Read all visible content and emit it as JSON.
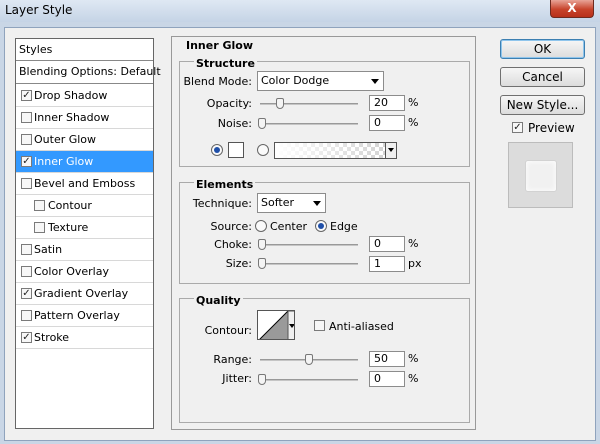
{
  "window": {
    "title": "Layer Style",
    "close": "X"
  },
  "styles_list": {
    "header": "Styles",
    "blending": "Blending Options: Default",
    "items": [
      {
        "label": "Drop Shadow",
        "checked": true
      },
      {
        "label": "Inner Shadow",
        "checked": false
      },
      {
        "label": "Outer Glow",
        "checked": false
      },
      {
        "label": "Inner Glow",
        "checked": true,
        "selected": true
      },
      {
        "label": "Bevel and Emboss",
        "checked": false
      },
      {
        "label": "Contour",
        "checked": false
      },
      {
        "label": "Texture",
        "checked": false
      },
      {
        "label": "Satin",
        "checked": false
      },
      {
        "label": "Color Overlay",
        "checked": false
      },
      {
        "label": "Gradient Overlay",
        "checked": true
      },
      {
        "label": "Pattern Overlay",
        "checked": false
      },
      {
        "label": "Stroke",
        "checked": true
      }
    ]
  },
  "panel": {
    "title": "Inner Glow",
    "structure": {
      "title": "Structure",
      "blend_mode_label": "Blend Mode:",
      "blend_mode": "Color Dodge",
      "opacity_label": "Opacity:",
      "opacity": "20",
      "noise_label": "Noise:",
      "noise": "0",
      "unit": "%",
      "color_mode": "solid"
    },
    "elements": {
      "title": "Elements",
      "technique_label": "Technique:",
      "technique": "Softer",
      "source_label": "Source:",
      "source_center": "Center",
      "source_edge": "Edge",
      "source": "Edge",
      "choke_label": "Choke:",
      "choke": "0",
      "size_label": "Size:",
      "size": "1",
      "pct": "%",
      "px": "px"
    },
    "quality": {
      "title": "Quality",
      "contour_label": "Contour:",
      "anti_aliased": "Anti-aliased",
      "anti_aliased_checked": false,
      "range_label": "Range:",
      "range": "50",
      "jitter_label": "Jitter:",
      "jitter": "0",
      "pct": "%"
    }
  },
  "buttons": {
    "ok": "OK",
    "cancel": "Cancel",
    "new_style": "New Style...",
    "preview": "Preview",
    "preview_checked": true
  },
  "colors": {
    "selection": "#3399ff",
    "title_bar": "#c5d4e6",
    "close": "#c7432b"
  }
}
